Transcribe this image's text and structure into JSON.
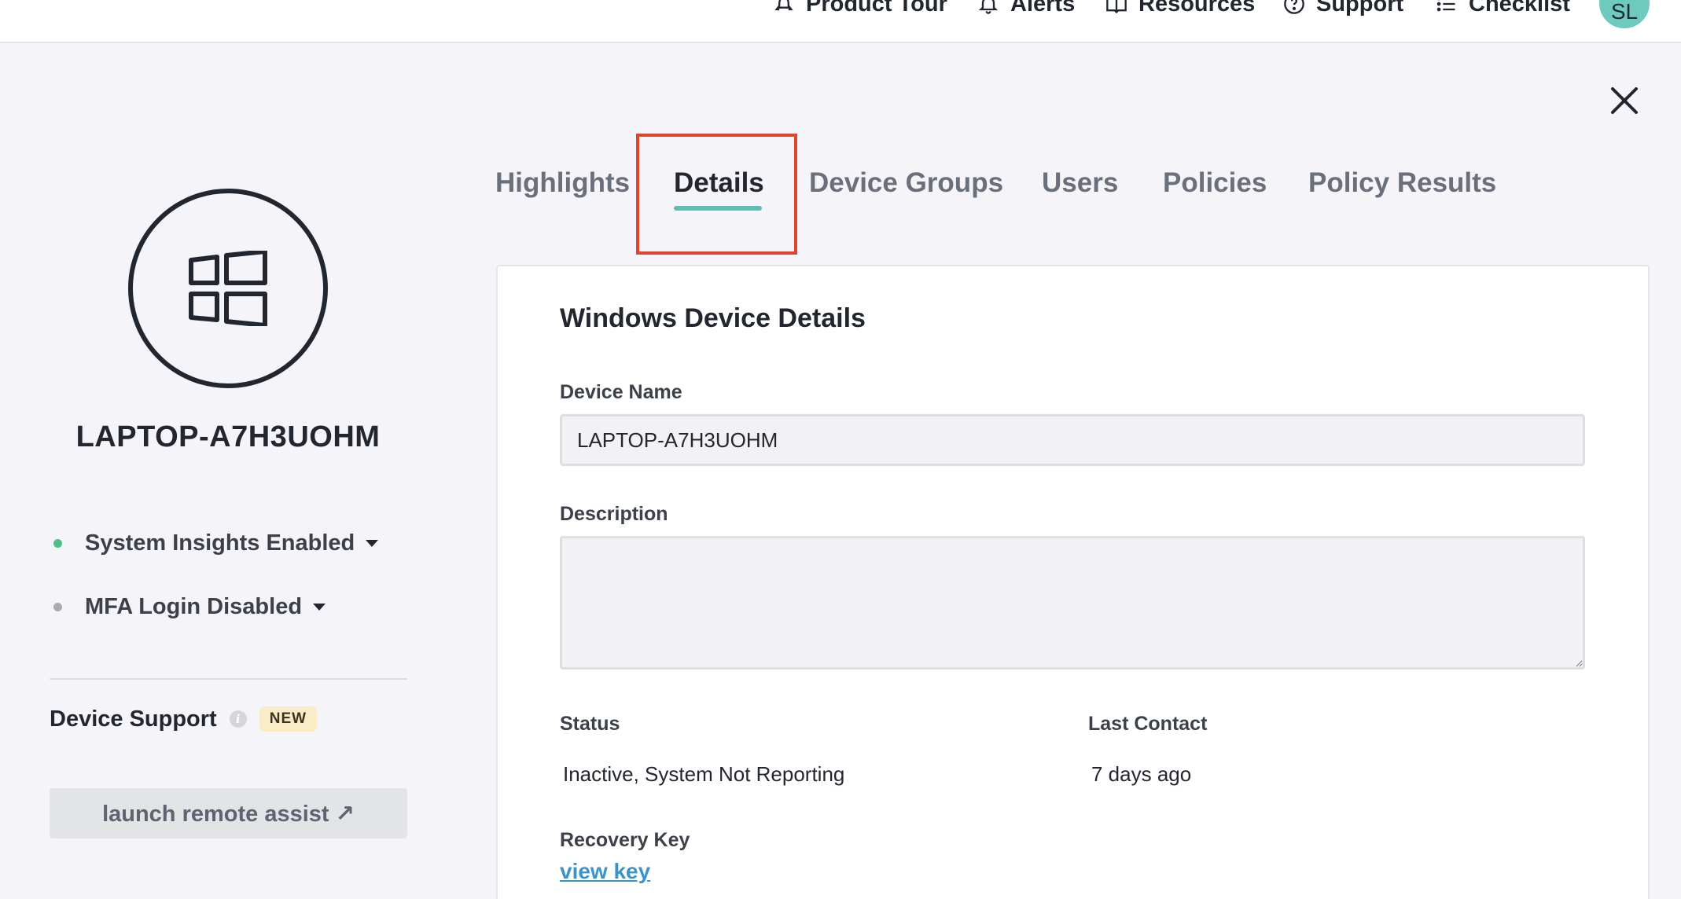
{
  "topnav": {
    "product_tour": "Product Tour",
    "alerts": "Alerts",
    "resources": "Resources",
    "support": "Support",
    "checklist": "Checklist",
    "avatar_initials": "SL"
  },
  "device": {
    "name": "LAPTOP-A7H3UOHM",
    "os_icon": "windows-icon",
    "status_items": [
      {
        "label": "System Insights Enabled",
        "dot_color": "#4cbf8a"
      },
      {
        "label": "MFA Login Disabled",
        "dot_color": "#a9abb0"
      }
    ]
  },
  "device_support": {
    "title": "Device Support",
    "badge": "NEW",
    "remote_button": "launch remote assist ↗"
  },
  "tabs": [
    {
      "label": "Highlights",
      "active": false
    },
    {
      "label": "Details",
      "active": true
    },
    {
      "label": "Device Groups",
      "active": false
    },
    {
      "label": "Users",
      "active": false
    },
    {
      "label": "Policies",
      "active": false
    },
    {
      "label": "Policy Results",
      "active": false
    }
  ],
  "details": {
    "title": "Windows Device Details",
    "device_name_label": "Device Name",
    "device_name_value": "LAPTOP-A7H3UOHM",
    "description_label": "Description",
    "description_value": "",
    "status_label": "Status",
    "status_value": "Inactive, System Not Reporting",
    "last_contact_label": "Last Contact",
    "last_contact_value": "7 days ago",
    "recovery_key_label": "Recovery Key",
    "recovery_key_link": "view key"
  },
  "colors": {
    "accent": "#5fbdb2",
    "highlight": "#e0442c",
    "link": "#3a94c9"
  }
}
